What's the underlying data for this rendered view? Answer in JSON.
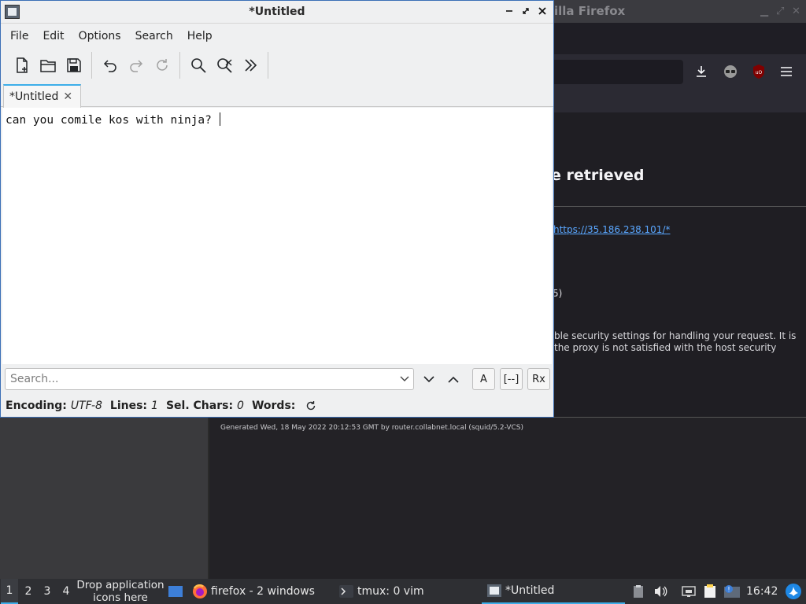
{
  "firefox": {
    "title_fragment": "illa Firefox",
    "heading_fragment": "e retrieved",
    "url": "https://35.186.238.101/*",
    "fragment_text": "5)",
    "paragraph": "ble security settings for handling your request. It is the proxy is not satisfied with the host security",
    "generated": "Generated Wed, 18 May 2022 20:12:53 GMT by router.collabnet.local (squid/5.2-VCS)"
  },
  "editor": {
    "title": "*Untitled",
    "menu": [
      "File",
      "Edit",
      "Options",
      "Search",
      "Help"
    ],
    "tab_label": "*Untitled",
    "text": "can you comile kos with ninja? ",
    "search_placeholder": "Search...",
    "status": {
      "encoding_label": "Encoding:",
      "encoding_value": "UTF-8",
      "lines_label": "Lines:",
      "lines_value": "1",
      "sel_label": "Sel. Chars:",
      "sel_value": "0",
      "words_label": "Words:"
    },
    "search_options": {
      "case": "A",
      "whole": "[--]",
      "regex": "Rx"
    }
  },
  "taskbar": {
    "workspaces": [
      "1",
      "2",
      "3",
      "4"
    ],
    "drop_label": "Drop application icons here",
    "tasks": [
      "firefox - 2 windows",
      "tmux: 0 vim",
      "*Untitled"
    ],
    "clock": "16:42"
  },
  "colors": {
    "accent": "#3daee9",
    "link": "#5aa7ff"
  }
}
